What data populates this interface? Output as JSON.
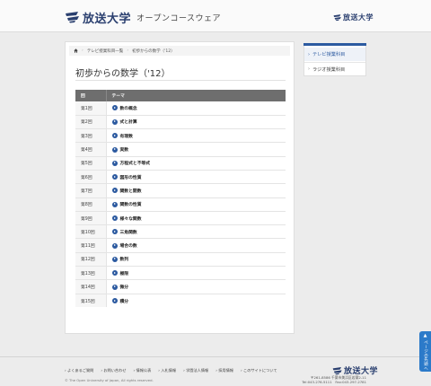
{
  "header": {
    "logo_text": "放送大学",
    "site_name": "オープンコースウェア",
    "right_logo_text": "放送大学",
    "brand_color": "#2a3f6f"
  },
  "breadcrumb": {
    "home_icon": "home-icon",
    "items": [
      "テレビ授業科目一覧",
      "初歩からの数学（'12）"
    ]
  },
  "page": {
    "title": "初歩からの数学（'12）"
  },
  "table": {
    "headers": [
      "回",
      "テーマ"
    ],
    "rows": [
      {
        "no": "第1回",
        "theme": "数の概念"
      },
      {
        "no": "第2回",
        "theme": "式と計算"
      },
      {
        "no": "第3回",
        "theme": "有理数"
      },
      {
        "no": "第4回",
        "theme": "実数"
      },
      {
        "no": "第5回",
        "theme": "方程式と不等式"
      },
      {
        "no": "第6回",
        "theme": "図形の性質"
      },
      {
        "no": "第7回",
        "theme": "関数と開数"
      },
      {
        "no": "第8回",
        "theme": "関数の性質"
      },
      {
        "no": "第9回",
        "theme": "様々な関数"
      },
      {
        "no": "第10回",
        "theme": "三角関数"
      },
      {
        "no": "第11回",
        "theme": "場合の数"
      },
      {
        "no": "第12回",
        "theme": "数列"
      },
      {
        "no": "第13回",
        "theme": "極限"
      },
      {
        "no": "第14回",
        "theme": "微分"
      },
      {
        "no": "第15回",
        "theme": "積分"
      }
    ],
    "header_color": "#6e6e6e",
    "link_icon": "circle-arrow-icon"
  },
  "sidebar": {
    "items": [
      {
        "label": "テレビ授業科目",
        "active": true
      },
      {
        "label": "ラジオ授業科目",
        "active": false
      }
    ],
    "accent_color": "#2c5aa0"
  },
  "footer": {
    "links": [
      "よくあるご質問",
      "お問い合わせ",
      "情報公表",
      "入札情報",
      "学園法人情報",
      "採用情報",
      "このサイトについて"
    ],
    "copyright": "© The Open University of Japan, All rights reserved.",
    "logo_text": "放送大学",
    "address_line1": "〒261-8586 千葉市美浜区若葉2-11",
    "address_line2": "Tel:043-276-5111　Fax:043-297-2781"
  },
  "to_top": {
    "label": "ページの先頭へ",
    "color": "#2c7ac9"
  }
}
